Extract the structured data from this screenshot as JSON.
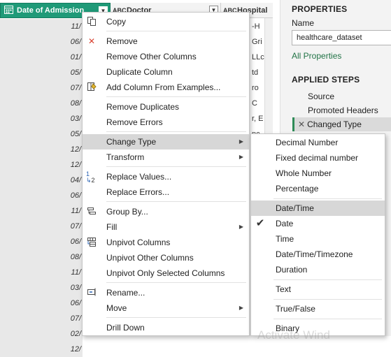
{
  "grid": {
    "headers": {
      "date": {
        "type": "calendar",
        "label": "Date of Admission"
      },
      "doctor": {
        "type": "ABC",
        "label": "Doctor"
      },
      "hospital": {
        "type": "ABC",
        "label": "Hospital"
      }
    },
    "date_cells": [
      "11/",
      "06/",
      "01/",
      "05/",
      "07/",
      "08/",
      "03/",
      "05/",
      "12/",
      "12/",
      "04/",
      "06/",
      "11/",
      "07/",
      "06/",
      "08/",
      "11/",
      "03/",
      "06/",
      "07/",
      "02/",
      "12/"
    ],
    "hospital_cells": [
      "-H",
      "Gri",
      "LLc",
      "td",
      "ro",
      "C",
      "r, E",
      "nc",
      "",
      "",
      "",
      ""
    ]
  },
  "properties": {
    "title": "PROPERTIES",
    "name_label": "Name",
    "name_value": "healthcare_dataset",
    "all_properties_link": "All Properties"
  },
  "applied_steps": {
    "title": "APPLIED STEPS",
    "steps": [
      "Source",
      "Promoted Headers",
      "Changed Type"
    ]
  },
  "context_menu": {
    "items": [
      {
        "label": "Copy",
        "icon": "copy-icon"
      },
      {
        "label": "Remove",
        "icon": "remove-icon"
      },
      {
        "label": "Remove Other Columns"
      },
      {
        "label": "Duplicate Column"
      },
      {
        "label": "Add Column From Examples...",
        "icon": "add-column-examples-icon"
      },
      {
        "label": "Remove Duplicates"
      },
      {
        "label": "Remove Errors"
      },
      {
        "label": "Change Type"
      },
      {
        "label": "Transform"
      },
      {
        "label": "Replace Values...",
        "icon": "replace-values-icon"
      },
      {
        "label": "Replace Errors..."
      },
      {
        "label": "Group By...",
        "icon": "group-by-icon"
      },
      {
        "label": "Fill"
      },
      {
        "label": "Unpivot Columns",
        "icon": "unpivot-icon"
      },
      {
        "label": "Unpivot Other Columns"
      },
      {
        "label": "Unpivot Only Selected Columns"
      },
      {
        "label": "Rename...",
        "icon": "rename-icon"
      },
      {
        "label": "Move"
      },
      {
        "label": "Drill Down"
      }
    ]
  },
  "submenu": {
    "items": [
      "Decimal Number",
      "Fixed decimal number",
      "Whole Number",
      "Percentage",
      "Date/Time",
      "Date",
      "Time",
      "Date/Time/Timezone",
      "Duration",
      "Text",
      "True/False",
      "Binary"
    ]
  },
  "watermark": "Activate Wind"
}
